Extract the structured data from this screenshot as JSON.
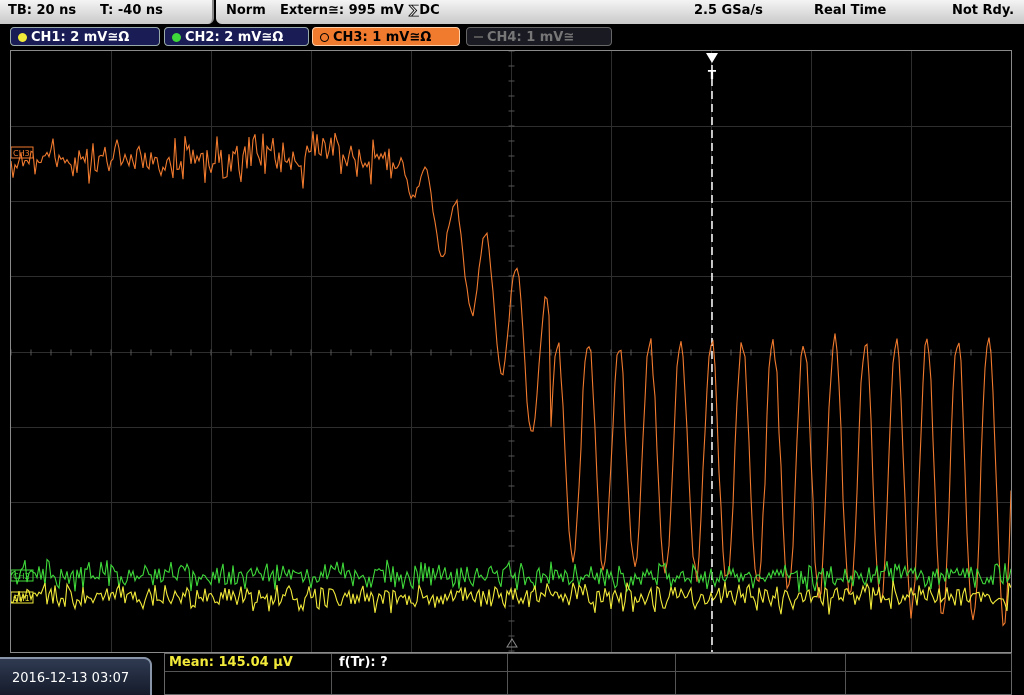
{
  "status": {
    "timebase": "TB: 20 ns",
    "trigger_offset": "T: -40 ns",
    "mode": "Norm",
    "trigger": "Extern≅: 995 mV ⅀DC",
    "sample_rate": "2.5 GSa/s",
    "acq_mode": "Real Time",
    "ready": "Not Rdy."
  },
  "channels": [
    {
      "label": "CH1: 2 mV≅Ω",
      "color": "#f2ea3a"
    },
    {
      "label": "CH2: 2 mV≅Ω",
      "color": "#3fd83a"
    },
    {
      "label": "CH3: 1 mV≅Ω",
      "color": "#f07a2e"
    },
    {
      "label": "CH4: 1 mV≅",
      "color": "#666666"
    }
  ],
  "markers": {
    "trigger": "T",
    "ch3": "CH3",
    "ch2": "CH2",
    "ch1": "CH1"
  },
  "footer": {
    "datetime": "2016-12-13 03:07",
    "mean": "Mean: 145.04 µV",
    "rise": "f(Tr): ?"
  },
  "colors": {
    "ch1": "#f2ea3a",
    "ch2": "#3fd83a",
    "ch3": "#f07a2e",
    "grid": "#3a3a3a"
  }
}
